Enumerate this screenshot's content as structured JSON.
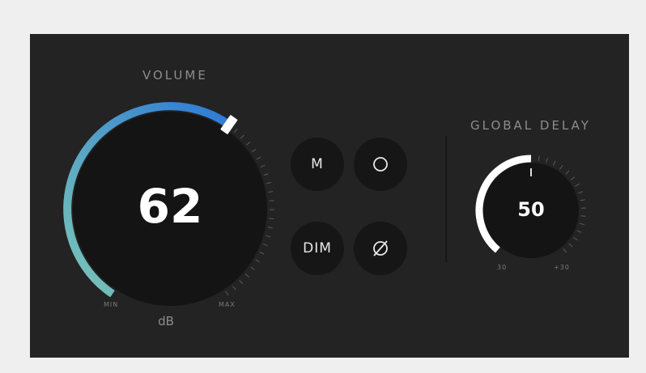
{
  "volume": {
    "title": "VOLUME",
    "value": "62",
    "unit": "dB",
    "min_label": "MIN",
    "max_label": "MAX",
    "level_fraction": 0.62,
    "colors": {
      "gradient_start": "#7cc6b6",
      "gradient_end": "#2b7ad8",
      "indicator": "#ffffff"
    }
  },
  "buttons": {
    "mute": "M",
    "solo_icon": "circle-icon",
    "dim": "DIM",
    "phase_icon": "phase-invert-icon"
  },
  "delay": {
    "title": "GLOBAL DELAY",
    "value": "50",
    "min_label": "30",
    "max_label": "+30",
    "level_fraction": 0.5,
    "colors": {
      "arc": "#ffffff"
    }
  }
}
